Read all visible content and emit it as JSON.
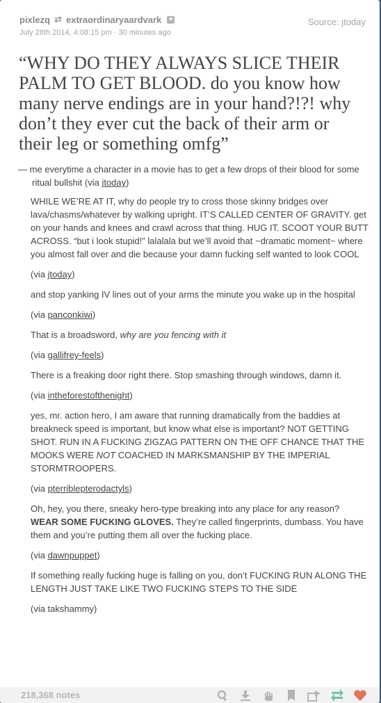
{
  "header": {
    "username": "pixlezq",
    "reblogged_from": "extraordinaryaardvark",
    "follow_symbol": "+",
    "timestamp": "July 28th 2014, 4:08:15 pm · 30 minutes ago",
    "source": "Source: jtoday"
  },
  "quote": {
    "text": "“WHY DO THEY ALWAYS SLICE THEIR PALM TO GET BLOOD. do you know how many nerve endings are in your hand?!?! why don’t they ever cut the back of their arm or their leg or something omfg”",
    "attribution": {
      "dash": "— ",
      "text": "me everytime a character in a movie has to get a few drops of their blood for some ritual bullshit",
      "via_open": "  (via ",
      "via_user": "jtoday",
      "via_close": ")"
    }
  },
  "reblogs": [
    {
      "text": "WHILE WE’RE AT IT, why do people try to cross those skinny bridges over lava/chasms/whatever by walking upright. IT’S CALLED CENTER OF GRAVITY. get on your hands and knees and crawl across that thing. HUG IT. SCOOT YOUR BUTT ACROSS. “but i look stupid!” lalalala but we’ll avoid that ~dramatic moment~ where you almost fall over and die because your damn fucking self wanted to look COOL",
      "via": "jtoday"
    },
    {
      "text": "and stop yanking IV lines out of your arms the minute you wake up in the hospital",
      "via": "panconkiwi"
    },
    {
      "text_plain": "That is a broadsword, ",
      "text_italic": "why are you fencing with it",
      "via": "gallifrey-feels"
    },
    {
      "text": "There is a freaking door right there. Stop smashing through windows, damn it.",
      "via": "intheforestofthenight"
    },
    {
      "text_before": "yes, mr. action hero, I am aware that running dramatically from the baddies at breakneck speed is important, but know what else is important? NOT GETTING SHOT. RUN IN A FUCKING ZIGZAG PATTERN ON THE OFF CHANCE THAT THE MOOKS WERE ",
      "text_italic": "NOT",
      "text_after": " COACHED IN MARKSMANSHIP BY THE IMPERIAL STORMTROOPERS.",
      "via": "pterriblepterodactyls"
    },
    {
      "text_before": "Oh, hey, you there, sneaky hero-type breaking into any place for any reason? ",
      "text_bold": "WEAR SOME FUCKING GLOVES.",
      "text_after": " They’re called fingerprints, dumbass. You have them and you’re putting them all over the fucking place.",
      "via": "dawnpuppet"
    },
    {
      "text": "If something really fucking huge is falling on you, don’t FUCKING RUN ALONG THE LENGTH JUST TAKE LIKE TWO FUCKING STEPS TO THE SIDE",
      "via_plain": "(via takshammy)"
    }
  ],
  "via_open": "(via ",
  "via_close": ")",
  "footer": {
    "notes": "218,368 notes",
    "icons": [
      "tag-icon",
      "download-icon",
      "hand-icon",
      "bookmark-icon",
      "share-icon",
      "reblog-icon",
      "heart-icon"
    ],
    "colors": {
      "reblog": "#56bc8a",
      "heart": "#d95e40",
      "icon": "#a8a8a8"
    }
  }
}
